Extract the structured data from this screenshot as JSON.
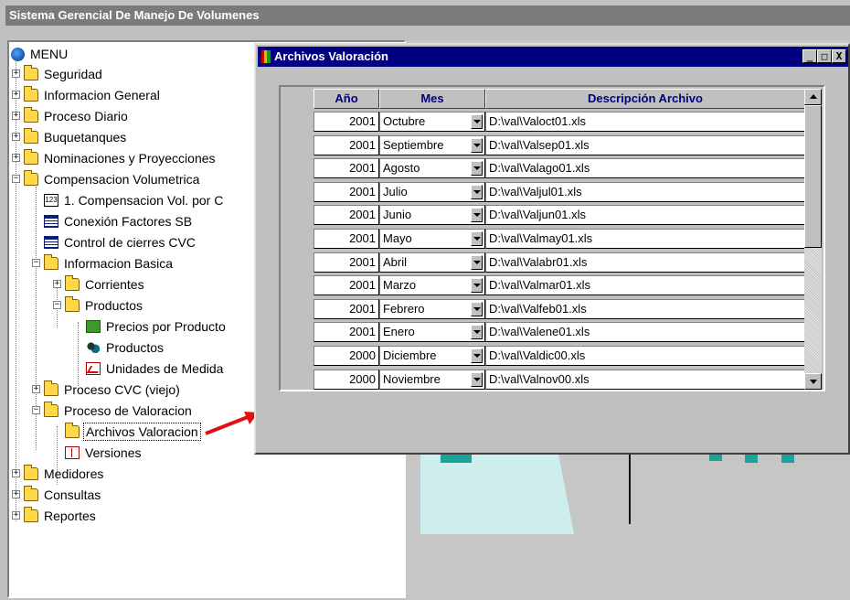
{
  "app": {
    "title": "Sistema Gerencial De Manejo De Volumenes"
  },
  "tree": {
    "root": "MENU",
    "items": [
      "Seguridad",
      "Informacion General",
      "Proceso Diario",
      "Buquetanques",
      "Nominaciones y Proyecciones",
      "Compensacion Volumetrica",
      "1. Compensacion Vol. por C",
      "Conexión Factores SB",
      "Control de cierres CVC",
      "Informacion Basica",
      "Corrientes",
      "Productos",
      "Precios por Producto",
      "Productos",
      "Unidades de Medida",
      "Proceso CVC (viejo)",
      "Proceso de Valoracion",
      "Archivos Valoracion",
      "Versiones",
      "Medidores",
      "Consultas",
      "Reportes"
    ]
  },
  "dialog": {
    "title": "Archivos Valoración",
    "window_buttons": {
      "minimize": "_",
      "maximize": "□",
      "close": "X"
    },
    "columns": [
      "Año",
      "Mes",
      "Descripción Archivo"
    ],
    "rows": [
      {
        "year": "2001",
        "month": "Octubre",
        "file": "D:\\val\\Valoct01.xls"
      },
      {
        "year": "2001",
        "month": "Septiembre",
        "file": "D:\\val\\Valsep01.xls"
      },
      {
        "year": "2001",
        "month": "Agosto",
        "file": "D:\\val\\Valago01.xls"
      },
      {
        "year": "2001",
        "month": "Julio",
        "file": "D:\\val\\Valjul01.xls"
      },
      {
        "year": "2001",
        "month": "Junio",
        "file": "D:\\val\\Valjun01.xls"
      },
      {
        "year": "2001",
        "month": "Mayo",
        "file": "D:\\val\\Valmay01.xls"
      },
      {
        "year": "2001",
        "month": "Abril",
        "file": "D:\\val\\Valabr01.xls"
      },
      {
        "year": "2001",
        "month": "Marzo",
        "file": "D:\\val\\Valmar01.xls"
      },
      {
        "year": "2001",
        "month": "Febrero",
        "file": "D:\\val\\Valfeb01.xls"
      },
      {
        "year": "2001",
        "month": "Enero",
        "file": "D:\\val\\Valene01.xls"
      },
      {
        "year": "2000",
        "month": "Diciembre",
        "file": "D:\\val\\Valdic00.xls"
      },
      {
        "year": "2000",
        "month": "Noviembre",
        "file": "D:\\val\\Valnov00.xls"
      }
    ]
  },
  "colors": {
    "title_bar": "#000080",
    "header_text": "#000080",
    "arrow": "#e01010"
  }
}
